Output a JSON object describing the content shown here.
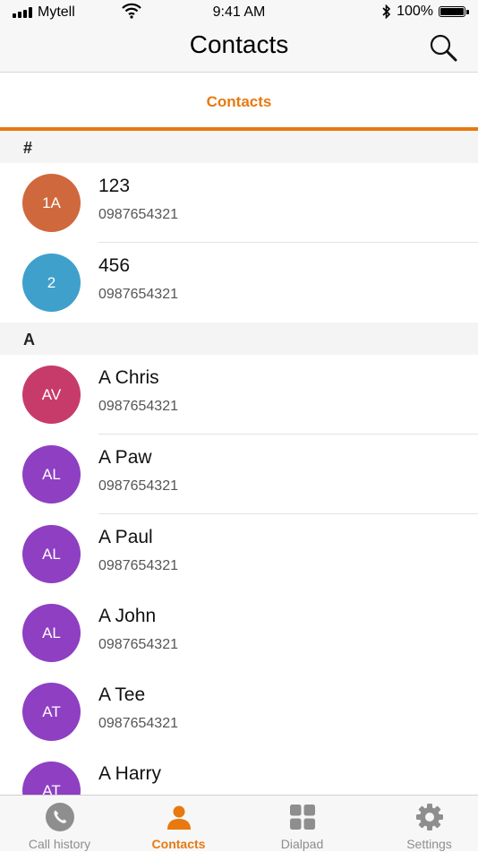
{
  "status_bar": {
    "carrier": "Mytell",
    "time": "9:41 AM",
    "battery": "100%",
    "icons": [
      "signal-icon",
      "wifi-icon",
      "bluetooth-icon",
      "battery-icon"
    ]
  },
  "nav_bar": {
    "title": "Contacts",
    "search_icon": "search-icon"
  },
  "tab_strip": {
    "label": "Contacts"
  },
  "sections": [
    {
      "header": "#",
      "contacts": [
        {
          "initials": "1A",
          "name": "123",
          "phone": "0987654321",
          "color": "#d0683d"
        },
        {
          "initials": "2",
          "name": "456",
          "phone": "0987654321",
          "color": "#3fa0cc"
        }
      ]
    },
    {
      "header": "A",
      "contacts": [
        {
          "initials": "AV",
          "name": "A Chris",
          "phone": "0987654321",
          "color": "#c73b6a"
        },
        {
          "initials": "AL",
          "name": "A Paw",
          "phone": "0987654321",
          "color": "#8e3fc2"
        },
        {
          "initials": "AL",
          "name": "A Paul",
          "phone": "0987654321",
          "color": "#8e3fc2"
        },
        {
          "initials": "AL",
          "name": "A John",
          "phone": "0987654321",
          "color": "#8e3fc2"
        },
        {
          "initials": "AT",
          "name": "A Tee",
          "phone": "0987654321",
          "color": "#8e3fc2"
        },
        {
          "initials": "AT",
          "name": "A Harry",
          "phone": "",
          "color": "#8e3fc2"
        }
      ]
    }
  ],
  "tab_bar": {
    "items": [
      {
        "label": "Call history",
        "icon": "phone-icon",
        "active": false
      },
      {
        "label": "Contacts",
        "icon": "person-icon",
        "active": true
      },
      {
        "label": "Dialpad",
        "icon": "dialpad-icon",
        "active": false
      },
      {
        "label": "Settings",
        "icon": "gear-icon",
        "active": false
      }
    ]
  },
  "colors": {
    "accent": "#e8790f",
    "inactive": "#8e8e8e"
  }
}
